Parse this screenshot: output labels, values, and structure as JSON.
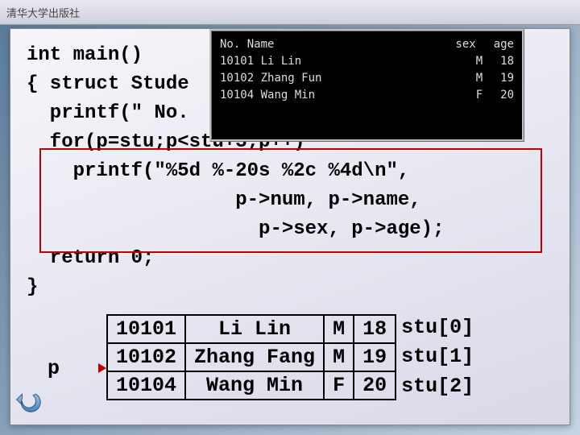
{
  "header": {
    "publisher": "清华大学出版社"
  },
  "code": {
    "l1": "int main()",
    "l2": "{ struct Stude",
    "l3": "  printf(\" No.  Name       sex  age\\n\");",
    "l4": "  for(p=stu;p<stu+3;p++)",
    "l5": "    printf(\"%5d %-20s %2c %4d\\n\",",
    "l6": "                  p->num, p->name,",
    "l7": "                    p->sex, p->age);",
    "l8": "  return 0;",
    "l9": "}"
  },
  "console": {
    "header_left": "No.   Name",
    "header_sex": "sex",
    "header_age": "age",
    "rows": [
      {
        "id": "10101",
        "name": "Li Lin",
        "sex": "M",
        "age": "18"
      },
      {
        "id": "10102",
        "name": "Zhang Fun",
        "sex": "M",
        "age": "19"
      },
      {
        "id": "10104",
        "name": "Wang Min",
        "sex": "F",
        "age": "20"
      }
    ]
  },
  "diagram": {
    "pointer": "p",
    "rows": [
      {
        "num": "10101",
        "name": "Li Lin",
        "sex": "M",
        "age": "18",
        "label": "stu[0]"
      },
      {
        "num": "10102",
        "name": "Zhang Fang",
        "sex": "M",
        "age": "19",
        "label": "stu[1]"
      },
      {
        "num": "10104",
        "name": "Wang Min",
        "sex": "F",
        "age": "20",
        "label": "stu[2]"
      }
    ]
  }
}
